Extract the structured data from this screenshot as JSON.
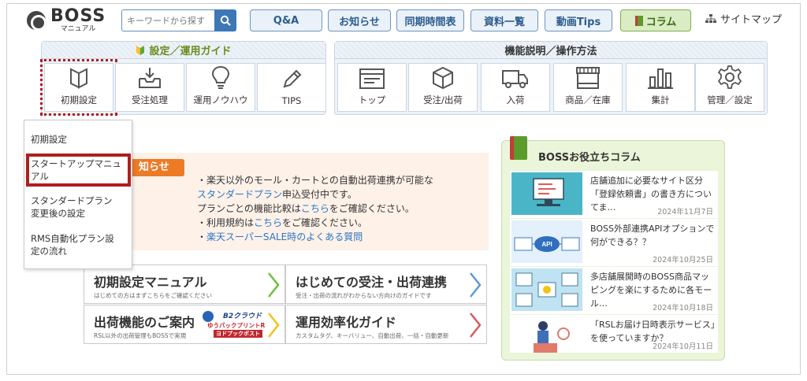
{
  "header": {
    "logo_name": "BOSS",
    "logo_sub": "マニュアル",
    "search_placeholder": "キーワードから探す",
    "nav": [
      "Q&A",
      "お知らせ",
      "同期時間表",
      "資料一覧",
      "動画Tips",
      "コラム"
    ],
    "sitemap": "サイトマップ"
  },
  "guide_panel": {
    "title": "設定／運用ガイド",
    "tiles": [
      {
        "label": "初期設定",
        "icon": "beginner-mark-icon"
      },
      {
        "label": "受注処理",
        "icon": "inbox-download-icon"
      },
      {
        "label": "運用ノウハウ",
        "icon": "lightbulb-icon"
      },
      {
        "label": "TIPS",
        "icon": "pencil-icon"
      }
    ]
  },
  "func_panel": {
    "title": "機能説明／操作方法",
    "tiles": [
      {
        "label": "トップ",
        "icon": "window-icon"
      },
      {
        "label": "受注/出荷",
        "icon": "box-icon"
      },
      {
        "label": "入荷",
        "icon": "truck-icon"
      },
      {
        "label": "商品／在庫",
        "icon": "store-icon"
      },
      {
        "label": "集計",
        "icon": "bar-chart-icon"
      },
      {
        "label": "管理／設定",
        "icon": "gear-icon"
      }
    ]
  },
  "dropdown": {
    "items": [
      {
        "line1": "初期設定",
        "line2": ""
      },
      {
        "line1": "スタートアップマニュ",
        "line2": "アル"
      },
      {
        "line1": "スタンダードプラン",
        "line2": "変更後の設定"
      },
      {
        "line1": "RMS自動化プラン設",
        "line2": "定の流れ"
      }
    ]
  },
  "notice": {
    "tab": "知らせ",
    "l1": "・楽天以外のモール・カートとの自動出荷連携が可能な",
    "l2_link": "スタンダードプラン",
    "l2_rest": "申込受付中です。",
    "l3_a": "プランごとの機能比較は",
    "l3_link": "こちら",
    "l3_b": "をご確認ください。",
    "l4_a": "・利用規約は",
    "l4_link": "こちら",
    "l4_b": "をご確認ください。",
    "l5_dot": "・",
    "l5_link": "楽天スーパーSALE時のよくある質問"
  },
  "cards": [
    {
      "title": "初期設定マニュアル",
      "sub": "はじめての方はまずこちらをご確認ください",
      "chevron_color": "#6cbf3b"
    },
    {
      "title": "はじめての受注・出荷連携",
      "sub": "受注・出荷の流れがわからない方向けのガイドです",
      "chevron_color": "#5b9bd5"
    },
    {
      "title": "出荷機能のご案内",
      "sub": "RSL以外の出荷管理もBOSSで実現",
      "chevron_color": "#f0c419"
    },
    {
      "title": "運用効率化ガイド",
      "sub": "カスタムタグ、キーバリュー、自動出荷、一括・自動更新",
      "chevron_color": "#d65a5a"
    }
  ],
  "b2_logo": {
    "brand": "B2クラウド",
    "line2": "ゆうパックプリントR",
    "line3": "ヨドプックポスト"
  },
  "column_box": {
    "title": "BOSSお役立ちコラム",
    "items": [
      {
        "text": "店舗追加に必要なサイト区分「登録依頼書」の書き方についてま…",
        "date": "2024年11月7日"
      },
      {
        "text": "BOSS外部連携APIオプションで何ができる？？",
        "date": "2024年10月25日"
      },
      {
        "text": "多店舗展開時のBOSS商品マッピングを楽にするために各モール…",
        "date": "2024年10月18日"
      },
      {
        "text": "「RSLお届け日時表示サービス」を使っていますか？",
        "date": "2024年10月11日"
      }
    ]
  },
  "colors": {
    "accent": "#3b78b5",
    "highlight": "#b01e1e",
    "notice_tab": "#ed7a25",
    "link": "#2a76c6"
  }
}
